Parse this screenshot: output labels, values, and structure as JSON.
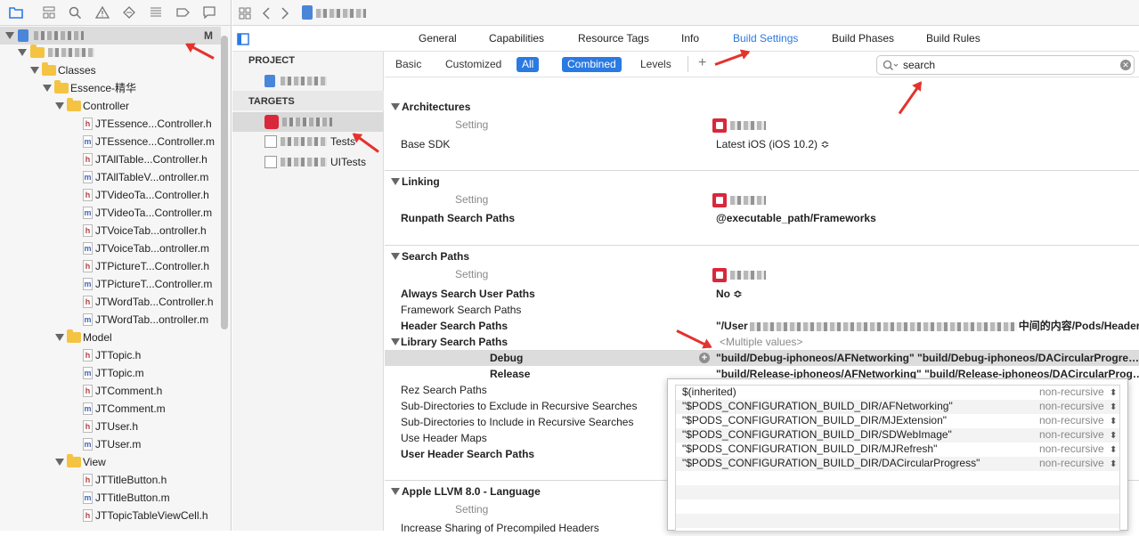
{
  "navigator": {
    "root_badge": "M",
    "classes_label": "Classes",
    "group_label": "Essence-精华",
    "controller_label": "Controller",
    "controller_files": [
      {
        "name": "JTEssence...Controller.h",
        "type": "h"
      },
      {
        "name": "JTEssence...Controller.m",
        "type": "m"
      },
      {
        "name": "JTAllTable...Controller.h",
        "type": "h"
      },
      {
        "name": "JTAllTableV...ontroller.m",
        "type": "m"
      },
      {
        "name": "JTVideoTa...Controller.h",
        "type": "h"
      },
      {
        "name": "JTVideoTa...Controller.m",
        "type": "m"
      },
      {
        "name": "JTVoiceTab...ontroller.h",
        "type": "h"
      },
      {
        "name": "JTVoiceTab...ontroller.m",
        "type": "m"
      },
      {
        "name": "JTPictureT...Controller.h",
        "type": "h"
      },
      {
        "name": "JTPictureT...Controller.m",
        "type": "m"
      },
      {
        "name": "JTWordTab...Controller.h",
        "type": "h"
      },
      {
        "name": "JTWordTab...ontroller.m",
        "type": "m"
      }
    ],
    "model_label": "Model",
    "model_files": [
      {
        "name": "JTTopic.h",
        "type": "h"
      },
      {
        "name": "JTTopic.m",
        "type": "m"
      },
      {
        "name": "JTComment.h",
        "type": "h"
      },
      {
        "name": "JTComment.m",
        "type": "m"
      },
      {
        "name": "JTUser.h",
        "type": "h"
      },
      {
        "name": "JTUser.m",
        "type": "m"
      }
    ],
    "view_label": "View",
    "view_files": [
      {
        "name": "JTTitleButton.h",
        "type": "h"
      },
      {
        "name": "JTTitleButton.m",
        "type": "m"
      },
      {
        "name": "JTTopicTableViewCell.h",
        "type": "h"
      }
    ]
  },
  "editor_tabs": [
    "General",
    "Capabilities",
    "Resource Tags",
    "Info",
    "Build Settings",
    "Build Phases",
    "Build Rules"
  ],
  "selected_tab": "Build Settings",
  "targets_panel": {
    "project_header": "PROJECT",
    "targets_header": "TARGETS",
    "tests_suffix": "Tests",
    "uitests_suffix": "UITests"
  },
  "filter_bar": {
    "basic": "Basic",
    "customized": "Customized",
    "all": "All",
    "combined": "Combined",
    "levels": "Levels",
    "add": "+",
    "search_value": "search"
  },
  "settings": {
    "architectures": {
      "title": "Architectures",
      "setting_label": "Setting",
      "base_sdk_label": "Base SDK",
      "base_sdk_value": "Latest iOS (iOS 10.2) ≎"
    },
    "linking": {
      "title": "Linking",
      "setting_label": "Setting",
      "runpath_label": "Runpath Search Paths",
      "runpath_value": "@executable_path/Frameworks"
    },
    "search_paths": {
      "title": "Search Paths",
      "setting_label": "Setting",
      "always_label": "Always Search User Paths",
      "always_value": "No ≎",
      "framework_label": "Framework Search Paths",
      "header_label": "Header Search Paths",
      "header_value_prefix": "\"/User",
      "header_value_suffix": "中间的内容/Pods/Headers…",
      "library_label": "Library Search Paths",
      "library_value": "<Multiple values>",
      "debug_label": "Debug",
      "debug_value": "\"build/Debug-iphoneos/AFNetworking\" \"build/Debug-iphoneos/DACircularProgre…",
      "release_label": "Release",
      "release_value": "\"build/Release-iphoneos/AFNetworking\" \"build/Release-iphoneos/DACircularProg…",
      "rez_label": "Rez Search Paths",
      "exclude_label": "Sub-Directories to Exclude in Recursive Searches",
      "include_label": "Sub-Directories to Include in Recursive Searches",
      "use_header_maps_label": "Use Header Maps",
      "user_header_label": "User Header Search Paths"
    },
    "llvm": {
      "title": "Apple LLVM 8.0 - Language",
      "setting_label": "Setting",
      "increase_label": "Increase Sharing of Precompiled Headers"
    }
  },
  "popover_rows": [
    {
      "path": "$(inherited)",
      "mode": "non-recursive"
    },
    {
      "path": "\"$PODS_CONFIGURATION_BUILD_DIR/AFNetworking\"",
      "mode": "non-recursive"
    },
    {
      "path": "\"$PODS_CONFIGURATION_BUILD_DIR/MJExtension\"",
      "mode": "non-recursive"
    },
    {
      "path": "\"$PODS_CONFIGURATION_BUILD_DIR/SDWebImage\"",
      "mode": "non-recursive"
    },
    {
      "path": "\"$PODS_CONFIGURATION_BUILD_DIR/MJRefresh\"",
      "mode": "non-recursive"
    },
    {
      "path": "\"$PODS_CONFIGURATION_BUILD_DIR/DACircularProgress\"",
      "mode": "non-recursive"
    }
  ],
  "colors": {
    "accent": "#2a7ae2",
    "arrow": "#e5322d",
    "folder": "#f5c342"
  }
}
